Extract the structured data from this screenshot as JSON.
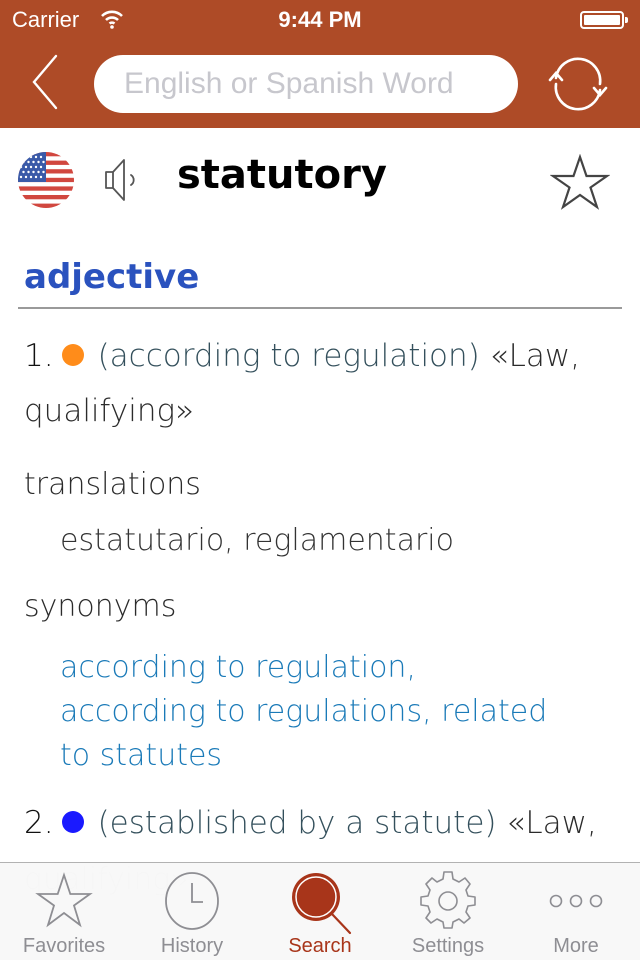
{
  "status_bar": {
    "carrier": "Carrier",
    "time": "9:44 PM",
    "battery_percent": 100
  },
  "nav": {
    "back_icon": "chevron-left-icon",
    "search_placeholder": "English or Spanish Word",
    "search_value": "",
    "refresh_icon": "refresh-icon"
  },
  "entry": {
    "language_flag": "us-flag",
    "audio_icon": "speaker-icon",
    "headword": "statutory",
    "favorite_icon": "star-outline-icon",
    "part_of_speech": "adjective",
    "senses": [
      {
        "number": "1.",
        "dot_color": "#ff8c1a",
        "gloss": "(according to regulation)",
        "label_line1": "«Law,",
        "label_line2": "qualifying»",
        "translations_heading": "translations",
        "translations": "estatutario, reglamentario",
        "synonyms_heading": "synonyms",
        "synonyms": [
          "according to regulation,",
          "according to regulations, related",
          "to statutes"
        ]
      },
      {
        "number": "2.",
        "dot_color": "#1a1aff",
        "gloss": "(established by a statute)",
        "label_line1": "«Law,",
        "label_line2": "qualifying»"
      }
    ]
  },
  "colors": {
    "brand": "#ae4b27",
    "tab_active": "#a8351a",
    "pos_blue": "#2a52be",
    "synonym_blue": "#1a7ab8"
  },
  "tabbar": {
    "tabs": [
      {
        "label": "Favorites",
        "icon": "star-icon",
        "active": false
      },
      {
        "label": "History",
        "icon": "clock-icon",
        "active": false
      },
      {
        "label": "Search",
        "icon": "search-icon",
        "active": true
      },
      {
        "label": "Settings",
        "icon": "gear-icon",
        "active": false
      },
      {
        "label": "More",
        "icon": "more-icon",
        "active": false
      }
    ]
  }
}
